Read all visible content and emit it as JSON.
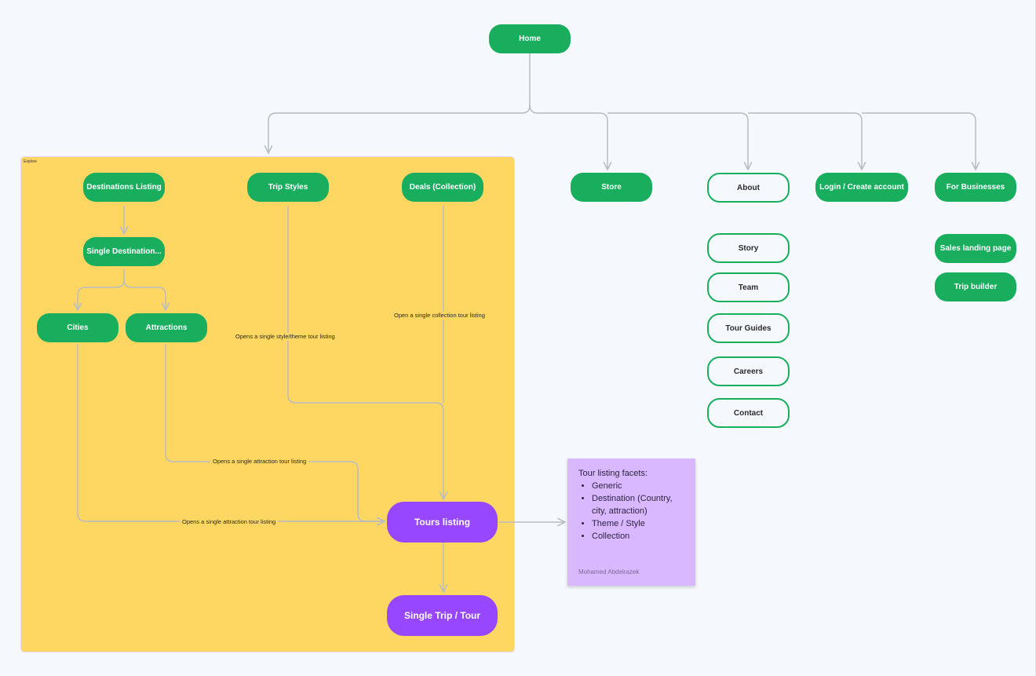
{
  "diagram": {
    "background_color": "#f5f9fd",
    "colors": {
      "primary_green": "#19ae5e",
      "purple": "#9747ff",
      "section_yellow": "#fed763",
      "sticky_purple": "#d9b8ff",
      "connector_gray": "#b8bcc2"
    },
    "root": {
      "label": "Home"
    },
    "section": {
      "label": "Explore",
      "nodes": {
        "destinations_listing": "Destinations Listing",
        "trip_styles": "Trip Styles",
        "deals_collection": "Deals (Collection)",
        "single_destination": "Single Destination...",
        "cities": "Cities",
        "attractions": "Attractions",
        "tours_listing": "Tours listing",
        "single_trip": "Single Trip / Tour"
      },
      "edge_labels": {
        "trip_styles_to_tours": "Opens a single style/theme tour listing",
        "deals_to_tours": "Open a single collection tour listing",
        "attractions_to_tours": "Opens a single attraction tour listing",
        "cities_to_tours": "Opens a single attraction tour listing"
      }
    },
    "top_level": {
      "store": "Store",
      "about": "About",
      "login": "Login / Create account",
      "for_businesses": "For Businesses"
    },
    "about_children": [
      "Story",
      "Team",
      "Tour Guides",
      "Careers",
      "Contact"
    ],
    "business_children": [
      "Sales landing page",
      "Trip builder"
    ],
    "sticky_note": {
      "title": "Tour listing facets:",
      "items": [
        "Generic",
        "Destination (Country, city, attraction)",
        "Theme / Style",
        "Collection"
      ],
      "author": "Mohamed Abdelrazek"
    }
  }
}
